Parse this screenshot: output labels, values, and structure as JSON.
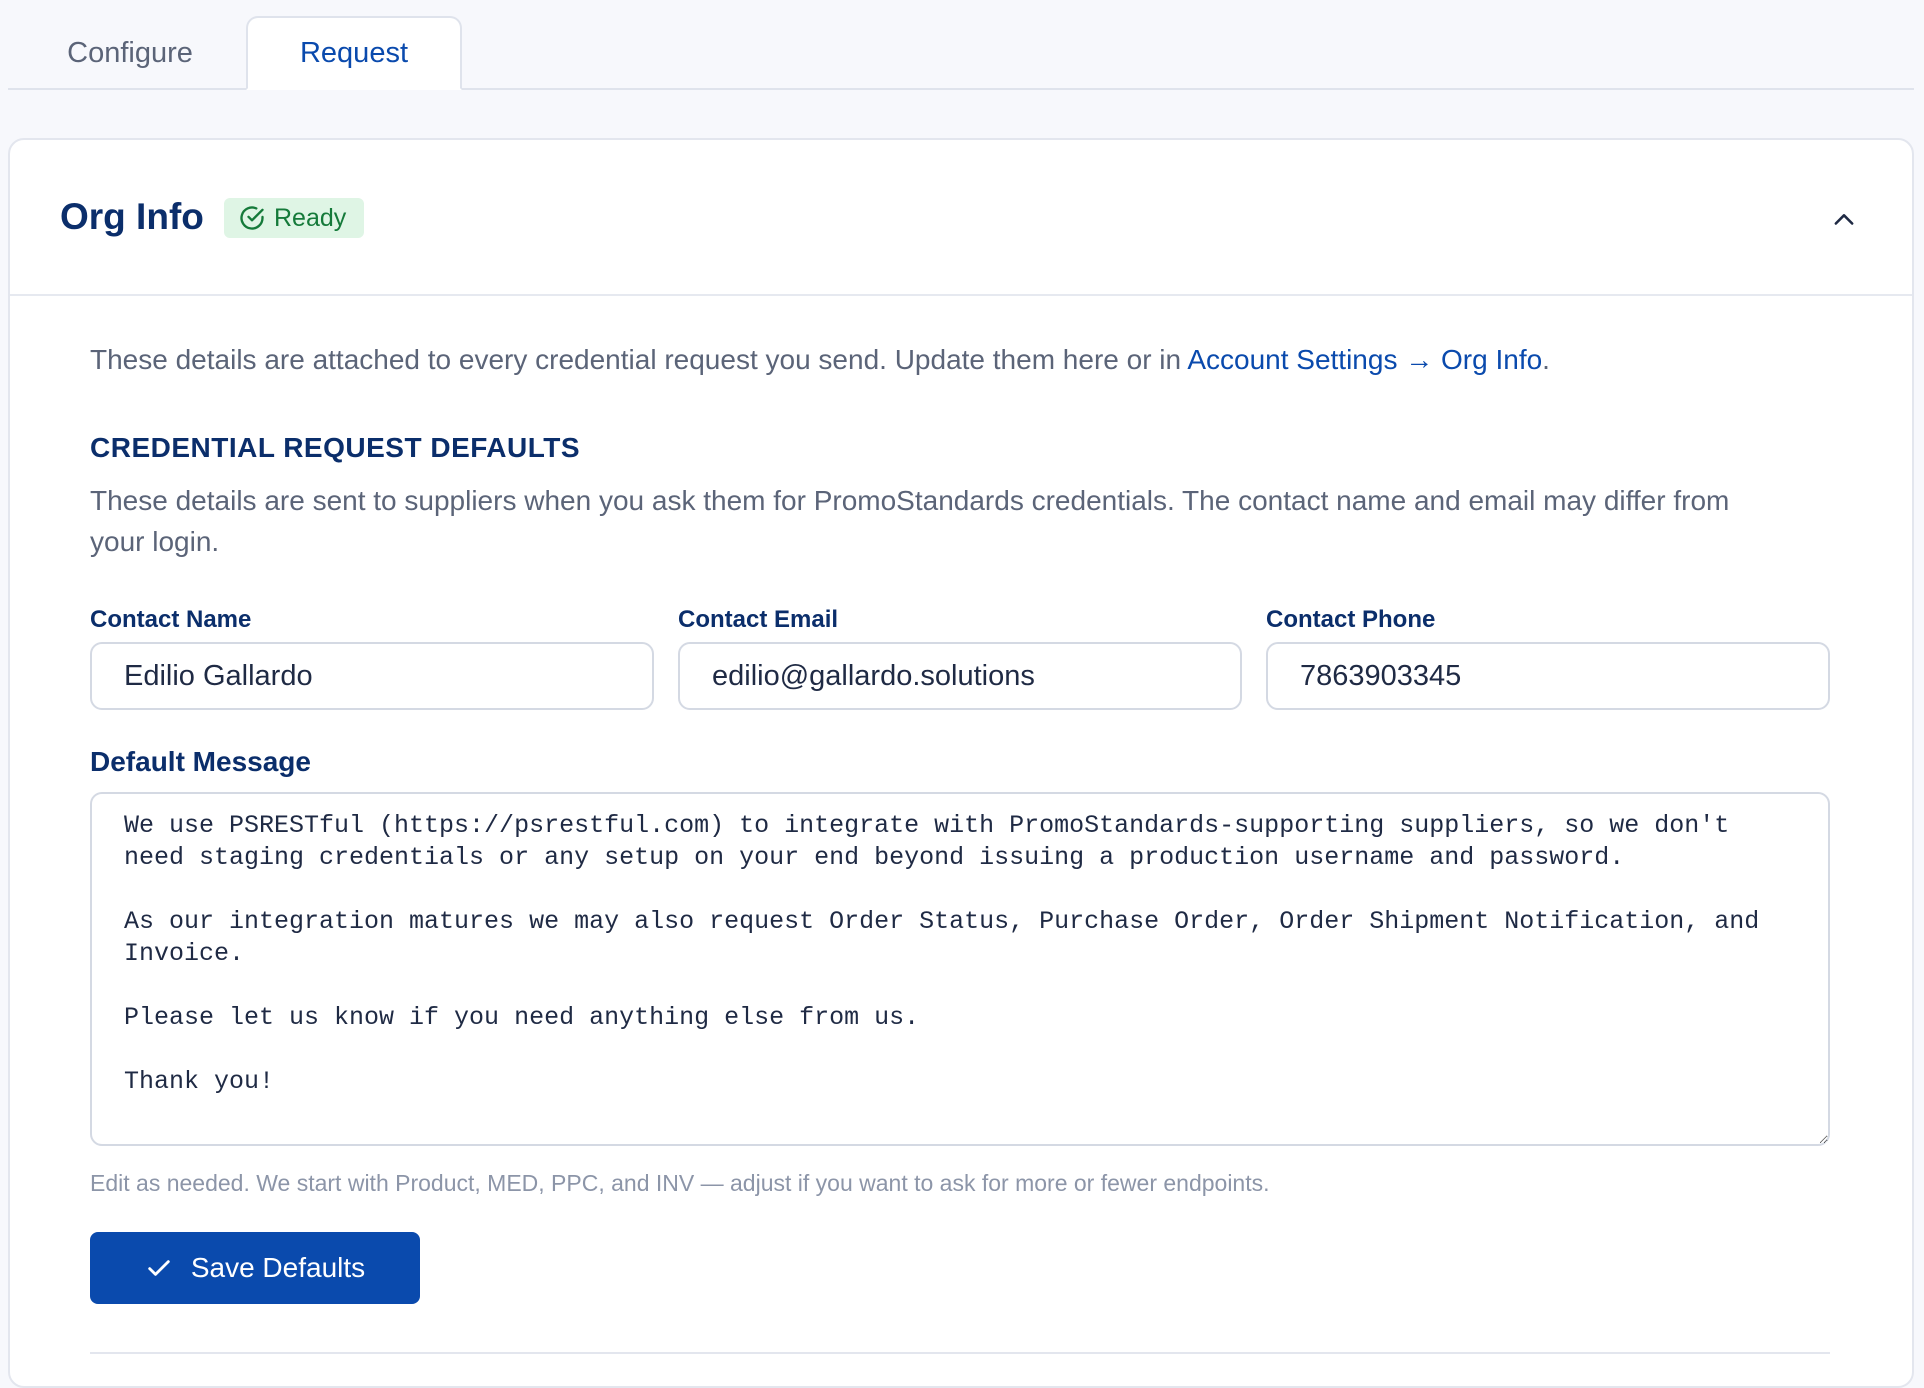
{
  "tabs": [
    {
      "label": "Configure",
      "active": false
    },
    {
      "label": "Request",
      "active": true
    }
  ],
  "card": {
    "title": "Org Info",
    "status_badge": "Ready",
    "status_icon": "check-circle-icon",
    "collapse_icon": "chevron-up-icon"
  },
  "intro": {
    "text": "These details are attached to every credential request you send. Update them here or in ",
    "link": "Account Settings → Org Info",
    "suffix": "."
  },
  "section": {
    "title": "CREDENTIAL REQUEST DEFAULTS",
    "description": "These details are sent to suppliers when you ask them for PromoStandards credentials. The contact name and email may differ from your login."
  },
  "fields": {
    "contact_name": {
      "label": "Contact Name",
      "value": "Edilio Gallardo"
    },
    "contact_email": {
      "label": "Contact Email",
      "value": "edilio@gallardo.solutions"
    },
    "contact_phone": {
      "label": "Contact Phone",
      "value": "7863903345"
    }
  },
  "message": {
    "label": "Default Message",
    "value": "We use PSRESTful (https://psrestful.com) to integrate with PromoStandards-supporting suppliers, so we don't need staging credentials or any setup on your end beyond issuing a production username and password.\n\nAs our integration matures we may also request Order Status, Purchase Order, Order Shipment Notification, and Invoice.\n\nPlease let us know if you need anything else from us.\n\nThank you!",
    "hint": "Edit as needed. We start with Product, MED, PPC, and INV — adjust if you want to ask for more or fewer endpoints."
  },
  "save_button": {
    "label": "Save Defaults",
    "icon": "check-icon"
  },
  "colors": {
    "primary": "#0a4aad",
    "heading": "#0b2e6b",
    "badge_bg": "#dff5e5",
    "badge_text": "#157a3a"
  }
}
